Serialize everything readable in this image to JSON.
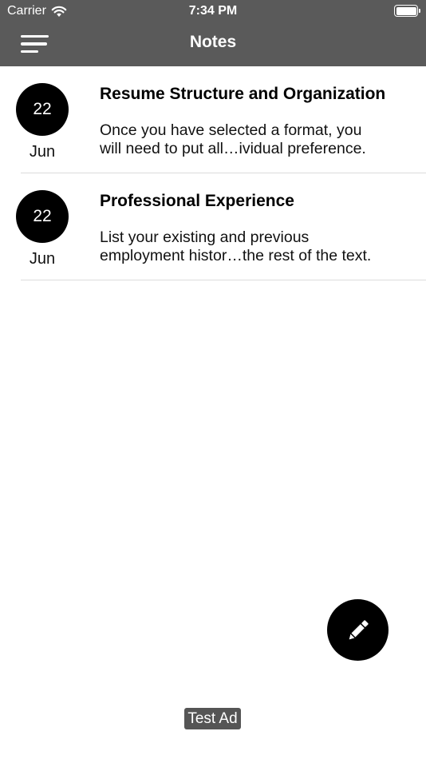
{
  "status_bar": {
    "carrier": "Carrier",
    "time": "7:34 PM"
  },
  "nav": {
    "title": "Notes"
  },
  "notes": [
    {
      "day": "22",
      "month": "Jun",
      "title": "Resume Structure and Organization",
      "preview_line1": "Once you have selected a format, you",
      "preview_line2": "will need to put all…ividual preference."
    },
    {
      "day": "22",
      "month": "Jun",
      "title": "Professional Experience",
      "preview_line1": "List your existing and previous",
      "preview_line2": "employment histor…the rest of the text."
    }
  ],
  "ad": {
    "label": "Test Ad"
  },
  "icons": {
    "menu": "hamburger-menu-icon",
    "fab": "pencil-icon",
    "wifi": "wifi-icon",
    "battery": "battery-icon"
  },
  "colors": {
    "bar_background": "#5a5a5a",
    "badge_background": "#000000",
    "fab_background": "#000000"
  }
}
